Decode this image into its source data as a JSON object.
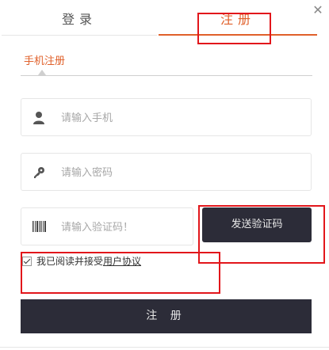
{
  "tabs": {
    "login": "登录",
    "register": "注册"
  },
  "close_icon": "close-icon",
  "subtab": {
    "label": "手机注册"
  },
  "form": {
    "phone": {
      "placeholder": "请输入手机",
      "value": "",
      "icon": "user-icon"
    },
    "password": {
      "placeholder": "请输入密码",
      "value": "",
      "icon": "key-icon"
    },
    "code": {
      "placeholder": "请输入验证码！",
      "value": "",
      "icon": "barcode-icon"
    },
    "send_code_label": "发送验证码",
    "agree": {
      "checked": true,
      "prefix": "我已阅读并接受",
      "link": "用户协议"
    },
    "submit_label": "注 册"
  },
  "colors": {
    "accent": "#e0602a",
    "dark_button": "#2c2c38",
    "highlight": "#e2161b"
  }
}
